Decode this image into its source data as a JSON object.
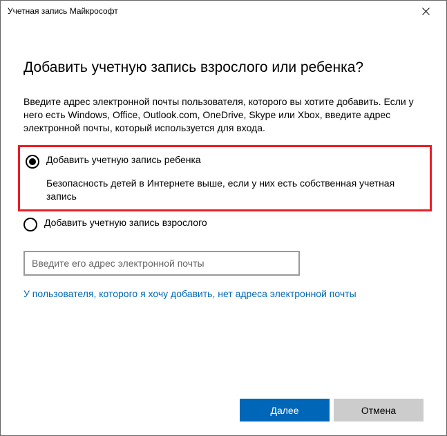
{
  "titlebar": {
    "title": "Учетная запись Майкрософт"
  },
  "main": {
    "heading": "Добавить учетную запись взрослого или ребенка?",
    "description": "Введите адрес электронной почты пользователя, которого вы хотите добавить. Если у него есть Windows, Office, Outlook.com, OneDrive, Skype или Xbox, введите адрес электронной почты, который используется для входа.",
    "options": {
      "child": {
        "label": "Добавить учетную запись ребенка",
        "sub": "Безопасность детей в Интернете выше, если у них есть собственная учетная запись",
        "selected": true
      },
      "adult": {
        "label": "Добавить учетную запись взрослого",
        "selected": false
      }
    },
    "email": {
      "placeholder": "Введите его адрес электронной почты",
      "value": ""
    },
    "link": "У пользователя, которого я хочу добавить, нет адреса электронной почты"
  },
  "buttons": {
    "next": "Далее",
    "cancel": "Отмена"
  }
}
